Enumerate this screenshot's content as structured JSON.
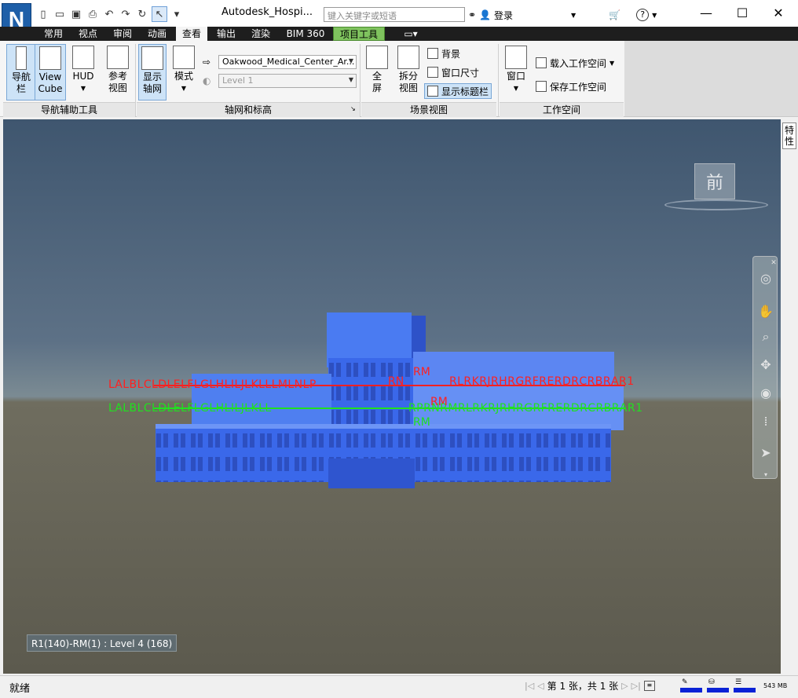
{
  "app": {
    "logo_letter": "N",
    "title": "Autodesk_Hospi...",
    "search_placeholder": "键入关键字或短语",
    "login_label": "登录"
  },
  "tabs": [
    {
      "label": "常用"
    },
    {
      "label": "视点"
    },
    {
      "label": "审阅"
    },
    {
      "label": "动画"
    },
    {
      "label": "查看",
      "active": true
    },
    {
      "label": "输出"
    },
    {
      "label": "渲染"
    },
    {
      "label": "BIM 360"
    },
    {
      "label": "项目工具",
      "contextual": true
    }
  ],
  "ribbon": {
    "nav_aids": {
      "title": "导航辅助工具",
      "buttons": [
        {
          "label": "导航\n栏"
        },
        {
          "label": "View\nCube"
        },
        {
          "label": "HUD"
        },
        {
          "label": "参考\n视图"
        }
      ]
    },
    "grids": {
      "title": "轴网和标高",
      "show_grid_label": "显示\n轴网",
      "mode_label": "模式",
      "model_combo": "Oakwood_Medical_Center_Ar...",
      "level_combo": "Level 1"
    },
    "scene_view": {
      "title": "场景视图",
      "fullscreen_label": "全\n屏",
      "split_label": "拆分\n视图",
      "background_label": "背景",
      "window_size_label": "窗口尺寸",
      "show_title_bar_label": "显示标题栏"
    },
    "workspace": {
      "title": "工作空间",
      "window_label": "窗口",
      "load_label": "载入工作空间",
      "save_label": "保存工作空间"
    }
  },
  "viewport": {
    "viewcube_face": "前",
    "properties_tab": "特性",
    "tooltip": "R1(140)-RM(1) : Level 4 (168)",
    "red_labels_left": "L A L B L C L D L E L F L G L H L I L J L K L L L M L N L P",
    "red_labels_right": "R L R K R J R H R G R F R E R D R C R B R A R 1",
    "green_labels_left": "L A L B L C L D L E L F L G L H L I L J L K L L",
    "green_labels_right": "R P R N R M R L R K R J R H R G R F R E R D R C R B R A R 1",
    "rm_label": "RM",
    "rn_label": "RN"
  },
  "status": {
    "ready": "就绪",
    "sheet": "第 1 张，共 1 张",
    "memory": "543 MB"
  },
  "colors": {
    "accent": "#1e5fa8",
    "grid_red": "#ff2020",
    "grid_green": "#20e020",
    "model_blue": "#3f6ff0",
    "contextual_tab": "#7fc35e"
  }
}
